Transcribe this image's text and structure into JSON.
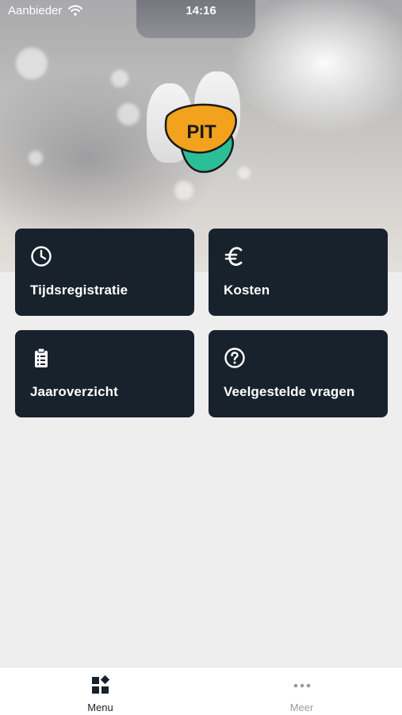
{
  "status_bar": {
    "carrier": "Aanbieder",
    "time": "14:16"
  },
  "hero": {
    "logo_text": "PIT"
  },
  "menu_tiles": [
    {
      "label": "Tijdsregistratie",
      "icon": "clock-icon"
    },
    {
      "label": "Kosten",
      "icon": "euro-icon"
    },
    {
      "label": "Jaaroverzicht",
      "icon": "clipboard-list-icon"
    },
    {
      "label": "Veelgestelde vragen",
      "icon": "question-circle-icon"
    }
  ],
  "tab_bar": {
    "tabs": [
      {
        "label": "Menu",
        "icon": "grid-icon",
        "active": true
      },
      {
        "label": "Meer",
        "icon": "more-dots-icon",
        "active": false
      }
    ]
  },
  "colors": {
    "tile_background": "#18222d",
    "page_background": "#eeeeee",
    "logo_orange": "#f2a21d",
    "logo_teal": "#2bbf97"
  }
}
